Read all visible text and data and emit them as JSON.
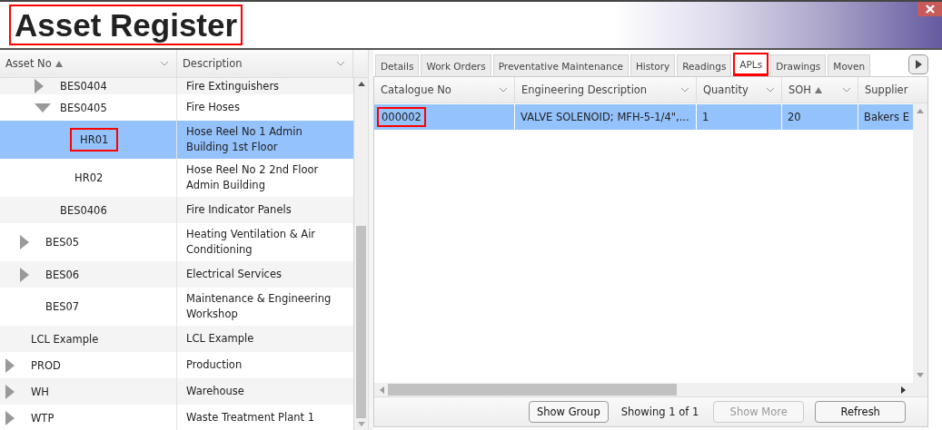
{
  "title": {
    "text": "Asset Register",
    "highlighted": true
  },
  "tree": {
    "columns": [
      {
        "label": "Asset No",
        "sorted_ascending": true
      },
      {
        "label": "Description",
        "sorted_ascending": false
      }
    ],
    "rows": [
      {
        "children": [
          {
            "children": [
              {
                "asset_no": "BES0404",
                "description": "Fire Extinguishers",
                "expanded": false,
                "selected": false,
                "highlighted": false
              },
              {
                "asset_no": "BES0405",
                "description": "Fire Hoses",
                "expanded": true,
                "selected": false,
                "highlighted": false,
                "children": [
                  {
                    "asset_no": "HR01",
                    "description": "Hose Reel No 1 Admin Building 1st Floor",
                    "selected": true,
                    "highlighted": true
                  },
                  {
                    "asset_no": "HR02",
                    "description": "Hose Reel No 2 2nd Floor Admin Building",
                    "selected": false,
                    "highlighted": false
                  }
                ]
              },
              {
                "asset_no": "BES0406",
                "description": "Fire Indicator Panels",
                "selected": false,
                "highlighted": false
              }
            ]
          },
          {
            "asset_no": "BES05",
            "description": "Heating Ventilation & Air Conditioning",
            "expanded": false,
            "selected": false,
            "highlighted": false
          },
          {
            "asset_no": "BES06",
            "description": "Electrical Services",
            "expanded": false,
            "selected": false,
            "highlighted": false
          },
          {
            "asset_no": "BES07",
            "description": "Maintenance & Engineering Workshop",
            "selected": false,
            "highlighted": false
          }
        ]
      },
      {
        "asset_no": "LCL Example",
        "description": "LCL Example",
        "selected": false,
        "highlighted": false
      },
      {
        "asset_no": "PROD",
        "description": "Production",
        "expanded": false,
        "selected": false,
        "highlighted": false
      },
      {
        "asset_no": "WH",
        "description": "Warehouse",
        "expanded": false,
        "selected": false,
        "highlighted": false
      },
      {
        "asset_no": "WTP",
        "description": "Waste Treatment Plant 1",
        "expanded": false,
        "selected": false,
        "highlighted": false
      }
    ]
  },
  "tabs": [
    {
      "label": "Details",
      "selected": false,
      "highlighted": false
    },
    {
      "label": "Work Orders",
      "selected": false,
      "highlighted": false
    },
    {
      "label": "Preventative Maintenance",
      "selected": false,
      "highlighted": false
    },
    {
      "label": "History",
      "selected": false,
      "highlighted": false
    },
    {
      "label": "Readings",
      "selected": false,
      "highlighted": false
    },
    {
      "label": "APLs",
      "selected": true,
      "highlighted": true
    },
    {
      "label": "Drawings",
      "selected": false,
      "highlighted": false
    },
    {
      "label": "Moven",
      "selected": false,
      "highlighted": false
    }
  ],
  "grid": {
    "columns": [
      {
        "label": "Catalogue No",
        "sorted_ascending": false
      },
      {
        "label": "Engineering Description",
        "sorted_ascending": false
      },
      {
        "label": "Quantity",
        "sorted_ascending": false
      },
      {
        "label": "SOH",
        "sorted_ascending": true
      },
      {
        "label": "Supplier",
        "sorted_ascending": false
      }
    ],
    "rows": [
      {
        "cells": [
          {
            "text": "000002",
            "highlighted": true
          },
          {
            "text": "VALVE SOLENOID; MFH-5-1/4\",...",
            "highlighted": false
          },
          {
            "text": "1",
            "highlighted": false
          },
          {
            "text": "20",
            "highlighted": false
          },
          {
            "text": "Bakers E",
            "highlighted": false
          }
        ],
        "selected": true
      }
    ]
  },
  "footer": {
    "show_group": "Show Group",
    "status": "Showing 1 of 1",
    "show_more": {
      "label": "Show More",
      "disabled": true
    },
    "refresh": "Refresh"
  }
}
